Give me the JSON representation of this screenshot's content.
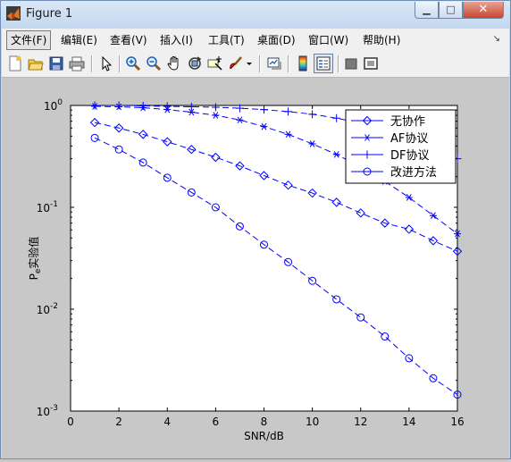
{
  "window": {
    "title": "Figure 1",
    "controls": {
      "minimize": "▁",
      "maximize": "□",
      "close": "✕"
    }
  },
  "menu": {
    "items": [
      "文件(F)",
      "编辑(E)",
      "查看(V)",
      "插入(I)",
      "工具(T)",
      "桌面(D)",
      "窗口(W)",
      "帮助(H)"
    ],
    "active_index": 0
  },
  "toolbar": {
    "icons": [
      "new-figure-icon",
      "open-file-icon",
      "save-icon",
      "print-icon",
      "select-arrow-icon",
      "zoom-in-icon",
      "zoom-out-icon",
      "pan-hand-icon",
      "rotate-3d-icon",
      "data-cursor-icon",
      "brush-icon",
      "brush-dropdown-icon",
      "link-plot-icon",
      "colorbar-icon",
      "legend-icon",
      "hide-plot-tools-icon",
      "show-plot-tools-icon"
    ]
  },
  "colors": {
    "series": "#0000ff",
    "axes": "#000000",
    "figure_bg": "#c8c8c8",
    "plot_bg": "#ffffff"
  },
  "chart_data": {
    "type": "line",
    "xlabel": "SNR/dB",
    "ylabel": "Pₑ实验值",
    "ylabel_main": "P",
    "ylabel_sub": "e",
    "ylabel_rest": "实验值",
    "xlim": [
      0,
      16
    ],
    "ylim": [
      0.001,
      1
    ],
    "yscale": "log",
    "xticks": [
      0,
      2,
      4,
      6,
      8,
      10,
      12,
      14,
      16
    ],
    "yticks": [
      {
        "value": 1,
        "base": "10",
        "exp": "0"
      },
      {
        "value": 0.1,
        "base": "10",
        "exp": "-1"
      },
      {
        "value": 0.01,
        "base": "10",
        "exp": "-2"
      },
      {
        "value": 0.001,
        "base": "10",
        "exp": "-3"
      }
    ],
    "legend_position": "top-right",
    "x": [
      1,
      2,
      3,
      4,
      5,
      6,
      7,
      8,
      9,
      10,
      11,
      12,
      13,
      14,
      15,
      16
    ],
    "series": [
      {
        "name": "无协作",
        "marker": "diamond",
        "values": [
          0.68,
          0.6,
          0.52,
          0.44,
          0.37,
          0.31,
          0.255,
          0.205,
          0.165,
          0.138,
          0.112,
          0.088,
          0.07,
          0.061,
          0.047,
          0.037
        ]
      },
      {
        "name": "AF协议",
        "marker": "asterisk",
        "values": [
          0.98,
          0.97,
          0.95,
          0.91,
          0.86,
          0.8,
          0.72,
          0.62,
          0.52,
          0.42,
          0.33,
          0.25,
          0.18,
          0.125,
          0.083,
          0.055
        ]
      },
      {
        "name": "DF协议",
        "marker": "plus",
        "values": [
          1.0,
          1.0,
          0.99,
          0.98,
          0.97,
          0.96,
          0.94,
          0.91,
          0.87,
          0.82,
          0.75,
          0.67,
          0.58,
          0.48,
          0.38,
          0.3
        ]
      },
      {
        "name": "改进方法",
        "marker": "circle",
        "values": [
          0.48,
          0.37,
          0.275,
          0.195,
          0.14,
          0.1,
          0.065,
          0.043,
          0.029,
          0.019,
          0.0125,
          0.0083,
          0.0054,
          0.0033,
          0.0021,
          0.00145
        ]
      }
    ]
  }
}
